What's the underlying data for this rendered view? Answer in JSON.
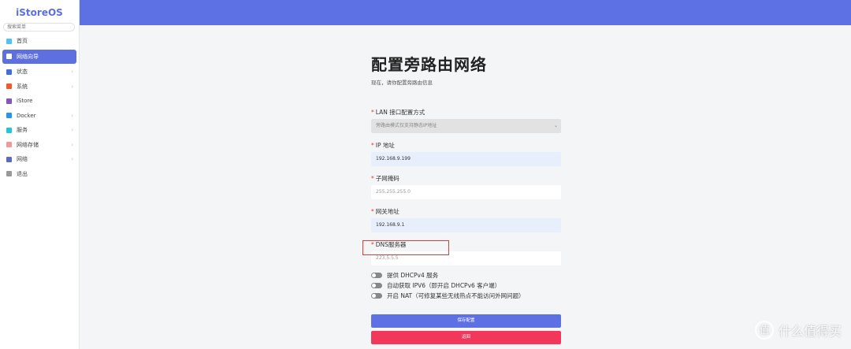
{
  "sidebar": {
    "logo": "iStoreOS",
    "search_placeholder": "搜索菜单",
    "items": [
      {
        "label": "首页",
        "color": "#4fc3f7",
        "chev": false
      },
      {
        "label": "网络向导",
        "color": "#ffffff",
        "chev": false,
        "active": true
      },
      {
        "label": "状态",
        "color": "#3f6fd8",
        "chev": true
      },
      {
        "label": "系统",
        "color": "#f05a28",
        "chev": true
      },
      {
        "label": "iStore",
        "color": "#7e57c2",
        "chev": false
      },
      {
        "label": "Docker",
        "color": "#2496ed",
        "chev": true
      },
      {
        "label": "服务",
        "color": "#26c6da",
        "chev": true
      },
      {
        "label": "网络存储",
        "color": "#ef9a9a",
        "chev": true
      },
      {
        "label": "网络",
        "color": "#5c6bc0",
        "chev": true
      },
      {
        "label": "退出",
        "color": "#999999",
        "chev": false
      }
    ]
  },
  "page": {
    "title": "配置旁路由网络",
    "subtitle": "现在，请你配置旁路由信息",
    "lan_label": "LAN 接口配置方式",
    "lan_value": "旁路由模式仅支持静态IP地址",
    "ip_label": "IP 地址",
    "ip_value": "192.168.9.199",
    "mask_label": "子网掩码",
    "mask_placeholder": "255.255.255.0",
    "gw_label": "网关地址",
    "gw_value": "192.168.9.1",
    "dns_label": "DNS服务器",
    "dns_placeholder": "223.5.5.5",
    "toggles": [
      "提供 DHCPv4 服务",
      "自动获取 IPV6（即开启 DHCPv6 客户端）",
      "开启 NAT（可修复某些无线热点不能访问外网问题）"
    ],
    "save": "保存配置",
    "back": "返回",
    "required": "*"
  },
  "watermark": {
    "text": "什么值得买",
    "glyph": "值"
  }
}
